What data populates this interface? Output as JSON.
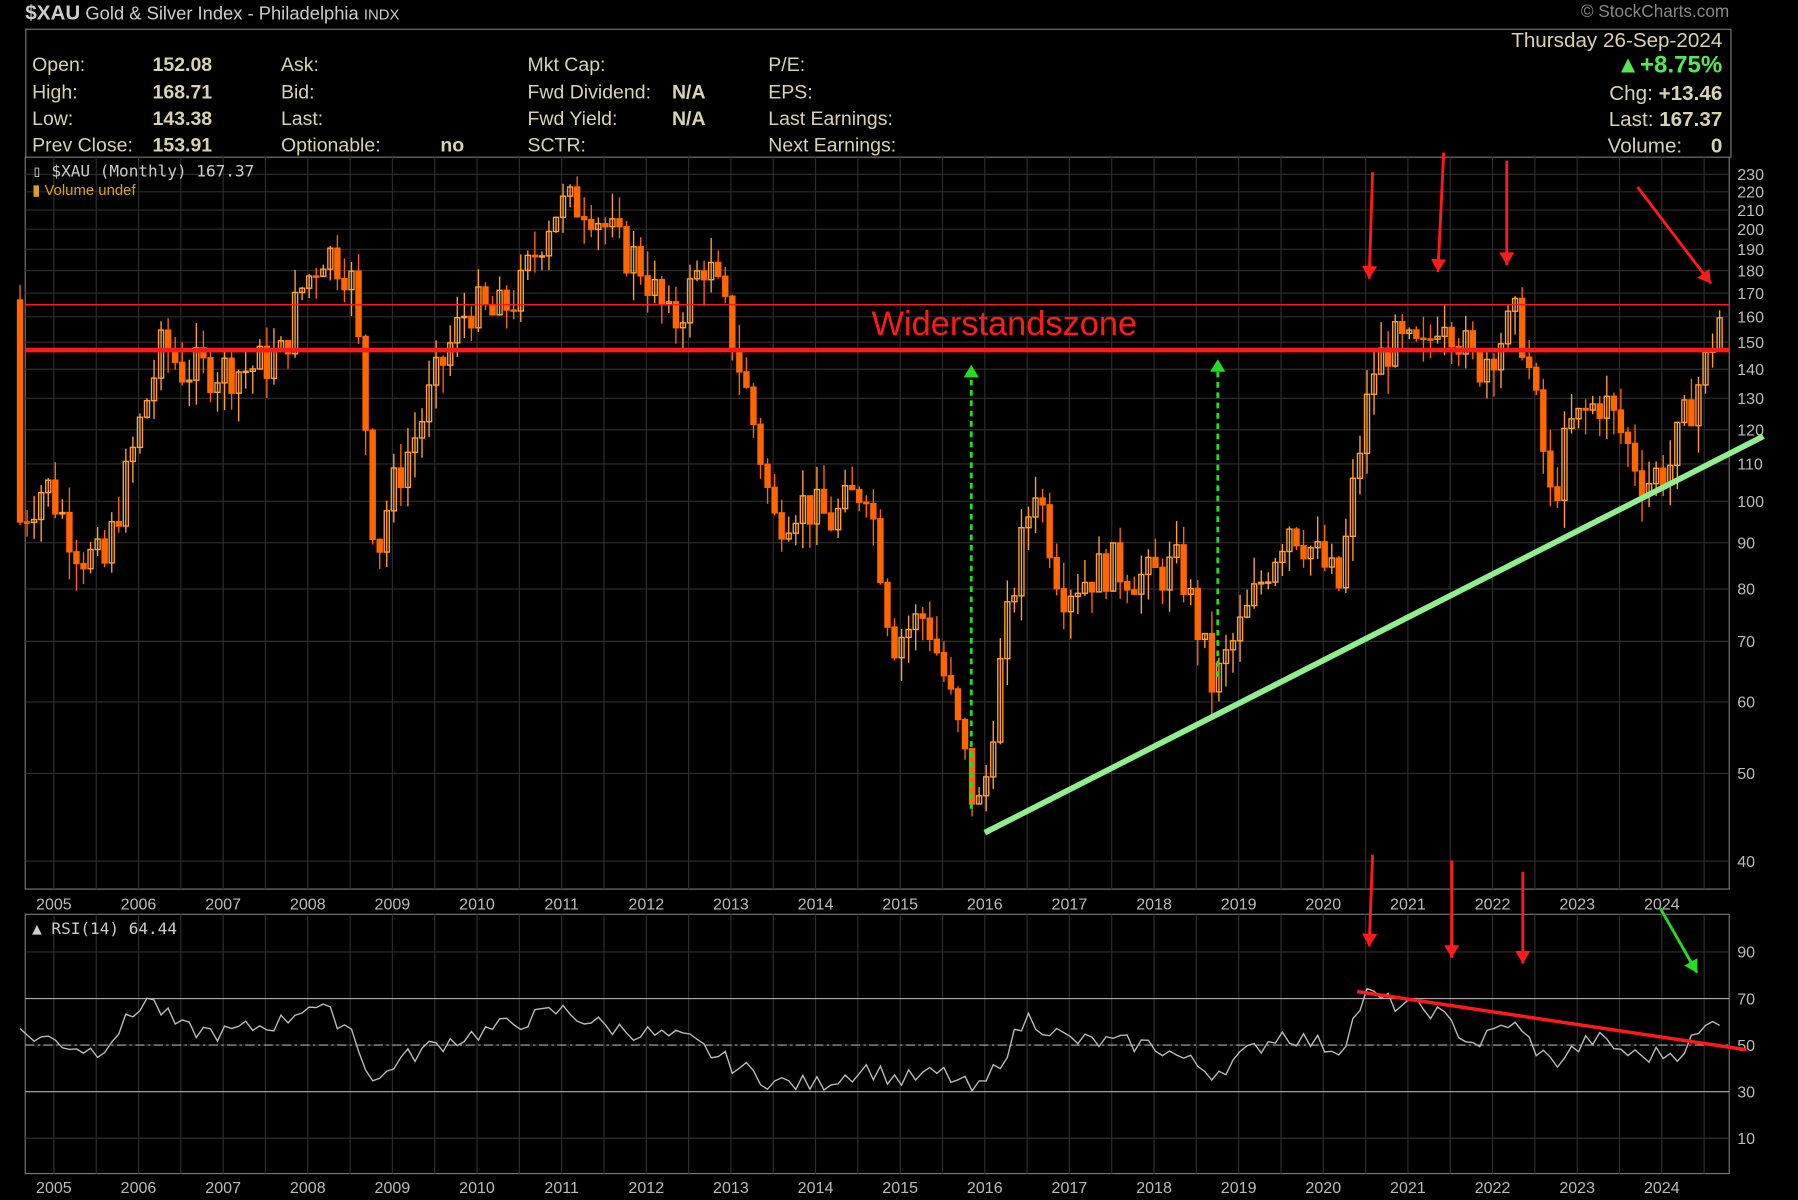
{
  "title": {
    "symbol": "$XAU",
    "name": "Gold & Silver Index - Philadelphia",
    "exchange": "INDX",
    "copyright": "© StockCharts.com"
  },
  "quote": {
    "open_label": "Open:",
    "open": "152.08",
    "high_label": "High:",
    "high": "168.71",
    "low_label": "Low:",
    "low": "143.38",
    "prev_label": "Prev Close:",
    "prev": "153.91",
    "ask_label": "Ask:",
    "bid_label": "Bid:",
    "last_label_mid": "Last:",
    "optionable_label": "Optionable:",
    "optionable": "no",
    "mktcap_label": "Mkt Cap:",
    "fwd_div_label": "Fwd Dividend:",
    "fwd_div": "N/A",
    "fwd_yield_label": "Fwd Yield:",
    "fwd_yield": "N/A",
    "sctr_label": "SCTR:",
    "pe_label": "P/E:",
    "eps_label": "EPS:",
    "last_earn_label": "Last Earnings:",
    "next_earn_label": "Next Earnings:",
    "date": "Thursday  26-Sep-2024",
    "pct": "+8.75%",
    "chg_label": "Chg:",
    "chg": "+13.46",
    "last_label": "Last:",
    "last": "167.37",
    "vol_label": "Volume:",
    "vol": "0"
  },
  "colors": {
    "candle_up": "#ffa030",
    "candle_down": "#ff6600",
    "resistance": "#ff1a1a",
    "trend": "#90ee90",
    "arrow_green": "#22dd22",
    "rsi": "#bbbbbb",
    "grid": "#2e2e2e"
  },
  "chart_data": [
    {
      "type": "candlestick",
      "title": "$XAU (Monthly) 167.37",
      "legend2": "Volume undef",
      "scale": "log",
      "y_ticks": [
        230,
        220,
        210,
        200,
        190,
        180,
        170,
        160,
        150,
        140,
        130,
        120,
        110,
        100,
        90,
        80,
        70,
        60,
        50,
        40
      ],
      "x_ticks": [
        "2005",
        "2006",
        "2007",
        "2008",
        "2009",
        "2010",
        "2011",
        "2012",
        "2013",
        "2014",
        "2015",
        "2016",
        "2017",
        "2018",
        "2019",
        "2020",
        "2021",
        "2022",
        "2023",
        "2024"
      ],
      "close_keypoints": [
        [
          2004.6,
          95
        ],
        [
          2004.9,
          105
        ],
        [
          2005.3,
          88
        ],
        [
          2005.6,
          85
        ],
        [
          2005.9,
          110
        ],
        [
          2006.3,
          150
        ],
        [
          2006.5,
          140
        ],
        [
          2006.9,
          140
        ],
        [
          2007.3,
          140
        ],
        [
          2007.7,
          145
        ],
        [
          2007.9,
          170
        ],
        [
          2008.2,
          190
        ],
        [
          2008.5,
          180
        ],
        [
          2008.8,
          85
        ],
        [
          2008.95,
          100
        ],
        [
          2009.3,
          120
        ],
        [
          2009.9,
          165
        ],
        [
          2010.2,
          160
        ],
        [
          2010.5,
          170
        ],
        [
          2010.9,
          210
        ],
        [
          2011.3,
          215
        ],
        [
          2011.7,
          190
        ],
        [
          2011.9,
          185
        ],
        [
          2012.3,
          155
        ],
        [
          2012.7,
          185
        ],
        [
          2012.9,
          165
        ],
        [
          2013.2,
          130
        ],
        [
          2013.5,
          95
        ],
        [
          2013.8,
          100
        ],
        [
          2014.2,
          95
        ],
        [
          2014.6,
          105
        ],
        [
          2014.9,
          70
        ],
        [
          2015.3,
          75
        ],
        [
          2015.6,
          60
        ],
        [
          2015.9,
          45
        ],
        [
          2016.0,
          48
        ],
        [
          2016.6,
          105
        ],
        [
          2016.9,
          80
        ],
        [
          2017.5,
          85
        ],
        [
          2017.9,
          82
        ],
        [
          2018.3,
          85
        ],
        [
          2018.7,
          62
        ],
        [
          2019.1,
          75
        ],
        [
          2019.6,
          95
        ],
        [
          2020.2,
          80
        ],
        [
          2020.6,
          140
        ],
        [
          2020.8,
          150
        ],
        [
          2021.2,
          145
        ],
        [
          2021.4,
          165
        ],
        [
          2021.8,
          140
        ],
        [
          2022.3,
          160
        ],
        [
          2022.7,
          98
        ],
        [
          2022.9,
          120
        ],
        [
          2023.3,
          130
        ],
        [
          2023.8,
          105
        ],
        [
          2024.1,
          110
        ],
        [
          2024.5,
          140
        ],
        [
          2024.75,
          167
        ]
      ],
      "annotations": {
        "zone_label": "Widerstandszone",
        "resistance_levels": [
          147,
          165
        ],
        "trendline": [
          [
            2016.0,
            43
          ],
          [
            2025.2,
            118
          ]
        ]
      }
    },
    {
      "type": "line",
      "title": "RSI(14) 64.44",
      "y_ticks": [
        90,
        70,
        50,
        30,
        10
      ],
      "ylim": [
        0,
        100
      ],
      "levels": [
        70,
        50,
        30
      ],
      "x_ticks": [
        "2005",
        "2006",
        "2007",
        "2008",
        "2009",
        "2010",
        "2011",
        "2012",
        "2013",
        "2014",
        "2015",
        "2016",
        "2017",
        "2018",
        "2019",
        "2020",
        "2021",
        "2022",
        "2023",
        "2024"
      ],
      "keypoints": [
        [
          2004.6,
          55
        ],
        [
          2005.0,
          52
        ],
        [
          2005.5,
          47
        ],
        [
          2006.0,
          65
        ],
        [
          2006.05,
          72
        ],
        [
          2006.5,
          57
        ],
        [
          2007,
          55
        ],
        [
          2007.7,
          60
        ],
        [
          2008.0,
          68
        ],
        [
          2008.5,
          58
        ],
        [
          2008.8,
          32
        ],
        [
          2009.0,
          42
        ],
        [
          2009.5,
          50
        ],
        [
          2010,
          55
        ],
        [
          2011,
          65
        ],
        [
          2011.5,
          58
        ],
        [
          2012,
          55
        ],
        [
          2012.5,
          52
        ],
        [
          2013,
          42
        ],
        [
          2013.5,
          34
        ],
        [
          2014,
          33
        ],
        [
          2014.6,
          40
        ],
        [
          2015,
          35
        ],
        [
          2015.5,
          38
        ],
        [
          2015.9,
          30
        ],
        [
          2016,
          33
        ],
        [
          2016.5,
          62
        ],
        [
          2017,
          52
        ],
        [
          2018,
          50
        ],
        [
          2018.7,
          38
        ],
        [
          2019.5,
          55
        ],
        [
          2020.2,
          48
        ],
        [
          2020.5,
          72
        ],
        [
          2020.8,
          68
        ],
        [
          2021.3,
          65
        ],
        [
          2021.8,
          50
        ],
        [
          2022.2,
          60
        ],
        [
          2022.7,
          42
        ],
        [
          2023.2,
          53
        ],
        [
          2023.7,
          45
        ],
        [
          2024.2,
          47
        ],
        [
          2024.75,
          64
        ]
      ],
      "annotations": {
        "trendline": [
          [
            2020.4,
            73
          ],
          [
            2025.0,
            48
          ]
        ]
      }
    }
  ]
}
